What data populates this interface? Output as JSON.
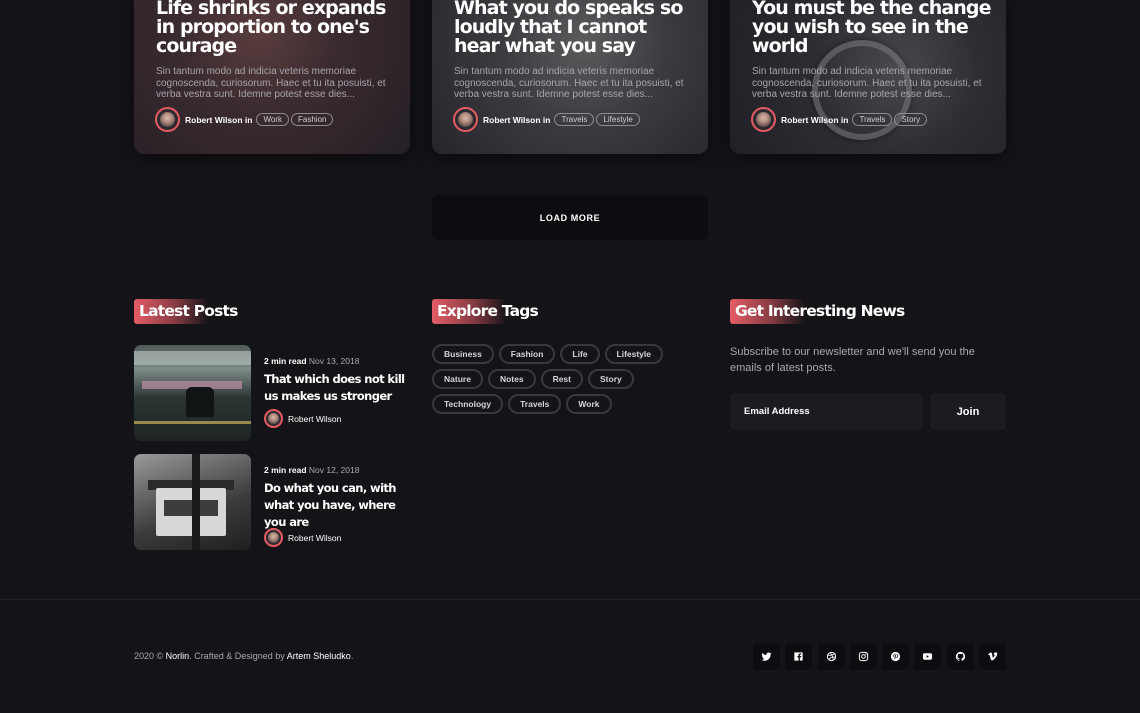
{
  "cards": [
    {
      "title": "Life shrinks or expands in proportion to one's courage",
      "excerpt": "Sin tantum modo ad indicia veteris memoriae cognoscenda, curiosorum. Haec et tu ita posuisti, et verba vestra sunt. Idemne potest esse dies...",
      "author": "Robert Wilson",
      "in_label": "in",
      "tags": [
        "Work",
        "Fashion"
      ]
    },
    {
      "title": "What you do speaks so loudly that I cannot hear what you say",
      "excerpt": "Sin tantum modo ad indicia veteris memoriae cognoscenda, curiosorum. Haec et tu ita posuisti, et verba vestra sunt. Idemne potest esse dies...",
      "author": "Robert Wilson",
      "in_label": "in",
      "tags": [
        "Travels",
        "Lifestyle"
      ]
    },
    {
      "title": "You must be the change you wish to see in the world",
      "excerpt": "Sin tantum modo ad indicia veteris memoriae cognoscenda, curiosorum. Haec et tu ita posuisti, et verba vestra sunt. Idemne potest esse dies...",
      "author": "Robert Wilson",
      "in_label": "in",
      "tags": [
        "Travels",
        "Story"
      ]
    }
  ],
  "load_more_label": "LOAD MORE",
  "latest_posts": {
    "heading": "Latest Posts",
    "items": [
      {
        "read_time": "2 min read",
        "date": "Nov 13, 2018",
        "title": "That which does not kill us makes us stronger",
        "author": "Robert Wilson"
      },
      {
        "read_time": "2 min read",
        "date": "Nov 12, 2018",
        "title": "Do what you can, with what you have, where you are",
        "author": "Robert Wilson"
      }
    ]
  },
  "explore_tags": {
    "heading": "Explore Tags",
    "rows": [
      [
        "Business",
        "Fashion",
        "Life",
        "Lifestyle"
      ],
      [
        "Nature",
        "Notes",
        "Rest",
        "Story"
      ],
      [
        "Technology",
        "Travels",
        "Work"
      ]
    ]
  },
  "newsletter": {
    "heading": "Get Interesting News",
    "text": "Subscribe to our newsletter and we'll send you the emails of latest posts.",
    "email_placeholder": "Email Address",
    "join_label": "Join"
  },
  "footer": {
    "year": "2020 ©",
    "site": "Norlin",
    "crafted": ". Crafted & Designed by",
    "designer": "Artem Sheludko",
    "end": ".",
    "social_icons": [
      "twitter-icon",
      "facebook-icon",
      "dribbble-icon",
      "instagram-icon",
      "pinterest-icon",
      "youtube-icon",
      "github-icon",
      "vimeo-icon"
    ]
  },
  "colors": {
    "background": "#141318",
    "accent": "#e45c66",
    "button_dark": "#0d0c10"
  }
}
